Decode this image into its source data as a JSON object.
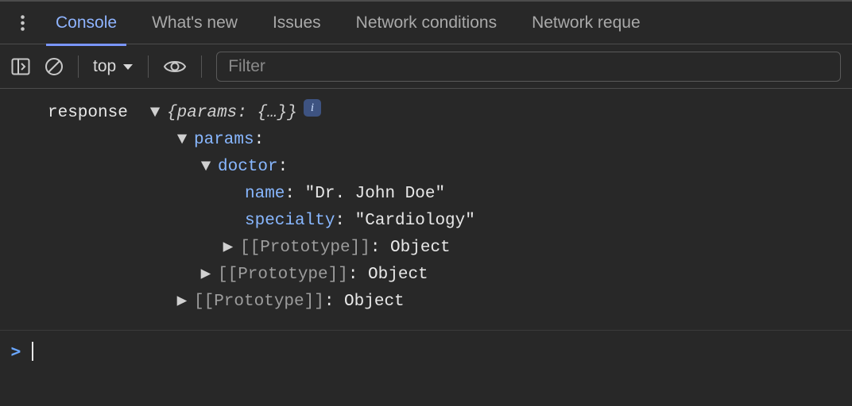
{
  "tabs": {
    "items": [
      {
        "label": "Console",
        "active": true
      },
      {
        "label": "What's new",
        "active": false
      },
      {
        "label": "Issues",
        "active": false
      },
      {
        "label": "Network conditions",
        "active": false
      },
      {
        "label": "Network reque",
        "active": false
      }
    ]
  },
  "toolbar": {
    "context": "top",
    "filter_placeholder": "Filter"
  },
  "console": {
    "var_name": "response",
    "summary_prefix": "{",
    "summary_prop": "params:",
    "summary_val": " {…}",
    "summary_suffix": "}",
    "info_badge": "i",
    "tree": {
      "params_label": "params",
      "doctor_label": "doctor",
      "name_label": "name",
      "name_value": "\"Dr. John Doe\"",
      "specialty_label": "specialty",
      "specialty_value": "\"Cardiology\"",
      "prototype_label": "[[Prototype]]",
      "prototype_value": "Object"
    },
    "prompt_caret": ">"
  }
}
